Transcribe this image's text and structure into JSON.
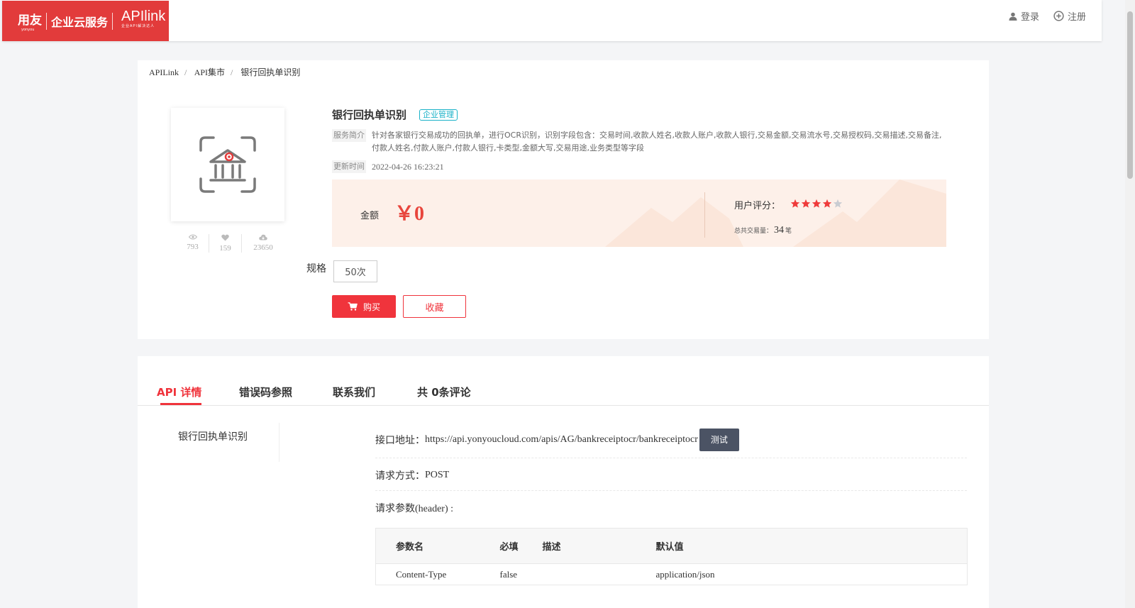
{
  "header": {
    "logo": {
      "brand": "用友",
      "brand_sub": "yonyou",
      "cloud": "企业云服务",
      "api": "APIlink",
      "api_tagline": "企业API解决达人"
    },
    "login": "登录",
    "register": "注册"
  },
  "breadcrumb": [
    "APILink",
    "API集市",
    "银行回执单识别"
  ],
  "product": {
    "title": "银行回执单识别",
    "tag": "企业管理",
    "intro_label": "服务简介",
    "intro": "针对各家银行交易成功的回执单，进行OCR识别，识别字段包含：交易时间,收款人姓名,收款人账户,收款人银行,交易金额,交易流水号,交易授权码,交易描述,交易备注,付款人姓名,付款人账户,付款人银行,卡类型,金额大写,交易用途,业务类型等字段",
    "update_label": "更新时间",
    "update_time": "2022-04-26 16:23:21",
    "views": "793",
    "likes": "159",
    "downloads": "23650",
    "amount_label": "金额",
    "amount": "￥0",
    "rating_label": "用户评分：",
    "rating": 4,
    "rating_max": 5,
    "total_label": "总共交易量：",
    "total_count": "34",
    "total_unit": "笔",
    "spec_label": "规格",
    "spec_option": "50次",
    "buy": "购买",
    "favorite": "收藏"
  },
  "tabs": [
    "API 详情",
    "错误码参照",
    "联系我们",
    "共 0条评论"
  ],
  "sidenav": [
    "银行回执单识别"
  ],
  "api": {
    "endpoint_label": "接口地址：",
    "endpoint": "https://api.yonyoucloud.com/apis/AG/bankreceiptocr/bankreceiptocr",
    "test": "测试",
    "method_label": "请求方式：",
    "method": "POST",
    "header_params_label": "请求参数(header) :",
    "table": {
      "headers": [
        "参数名",
        "必填",
        "描述",
        "默认值"
      ],
      "rows": [
        [
          "Content-Type",
          "false",
          "",
          "application/json"
        ]
      ]
    }
  },
  "colors": {
    "brand": "#e23b3b",
    "accent": "#f0343c",
    "tag": "#1ab2c8",
    "price_bg": "#fdf0e9",
    "test_btn": "#4b5364"
  }
}
